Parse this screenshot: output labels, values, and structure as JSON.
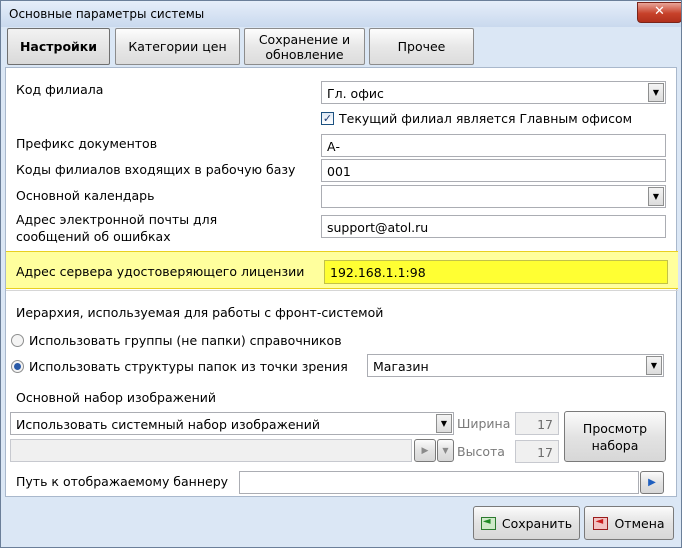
{
  "window": {
    "title": "Основные параметры системы",
    "close_label": "✕"
  },
  "tabs": [
    {
      "label": "Настройки",
      "active": true
    },
    {
      "label": "Категории цен",
      "active": false
    },
    {
      "label": "Сохранение и обновление",
      "active": false
    },
    {
      "label": "Прочее",
      "active": false
    }
  ],
  "form": {
    "branch_code_label": "Код филиала",
    "branch_code_value": "Гл. офис",
    "main_office_checkbox_label": "Текущий филиал является Главным офисом",
    "main_office_checked": true,
    "doc_prefix_label": "Префикс  документов",
    "doc_prefix_value": "А-",
    "incoming_branches_label": "Коды филиалов входящих в рабочую базу",
    "incoming_branches_value": "001",
    "calendar_label": "Основной календарь",
    "calendar_value": "",
    "error_email_label_line1": "Адрес электронной почты для",
    "error_email_label_line2": "сообщений об ошибках",
    "error_email_value": "support@atol.ru",
    "license_server_label": "Адрес сервера удостоверяющего лицензии",
    "license_server_value": "192.168.1.1:98",
    "hierarchy_label": "Иерархия, используемая для работы с фронт-системой",
    "radio_groups_label": "Использовать группы (не папки)  справочников",
    "radio_groups_selected": false,
    "radio_folders_label": "Использовать структуры папок из точки зрения",
    "radio_folders_selected": true,
    "viewpoint_value": "Магазин",
    "image_set_label": "Основной набор изображений",
    "image_set_value": "Использовать системный набор изображений",
    "image_path_value": "",
    "width_label": "Ширина",
    "width_value": "17",
    "height_label": "Высота",
    "height_value": "17",
    "preview_button_label": "Просмотр набора",
    "banner_path_label": "Путь к отображаемому баннеру",
    "banner_path_value": ""
  },
  "footer": {
    "save_label": "Сохранить",
    "cancel_label": "Отмена"
  },
  "colors": {
    "highlight_row": "#ffff9d",
    "highlight_field": "#ffff33",
    "window_frame": "#dbe7f5",
    "close_button": "#c7412a"
  },
  "icons": {
    "dropdown": "chevron-down-icon",
    "play": "play-icon",
    "save": "save-icon",
    "cancel": "cancel-icon"
  }
}
